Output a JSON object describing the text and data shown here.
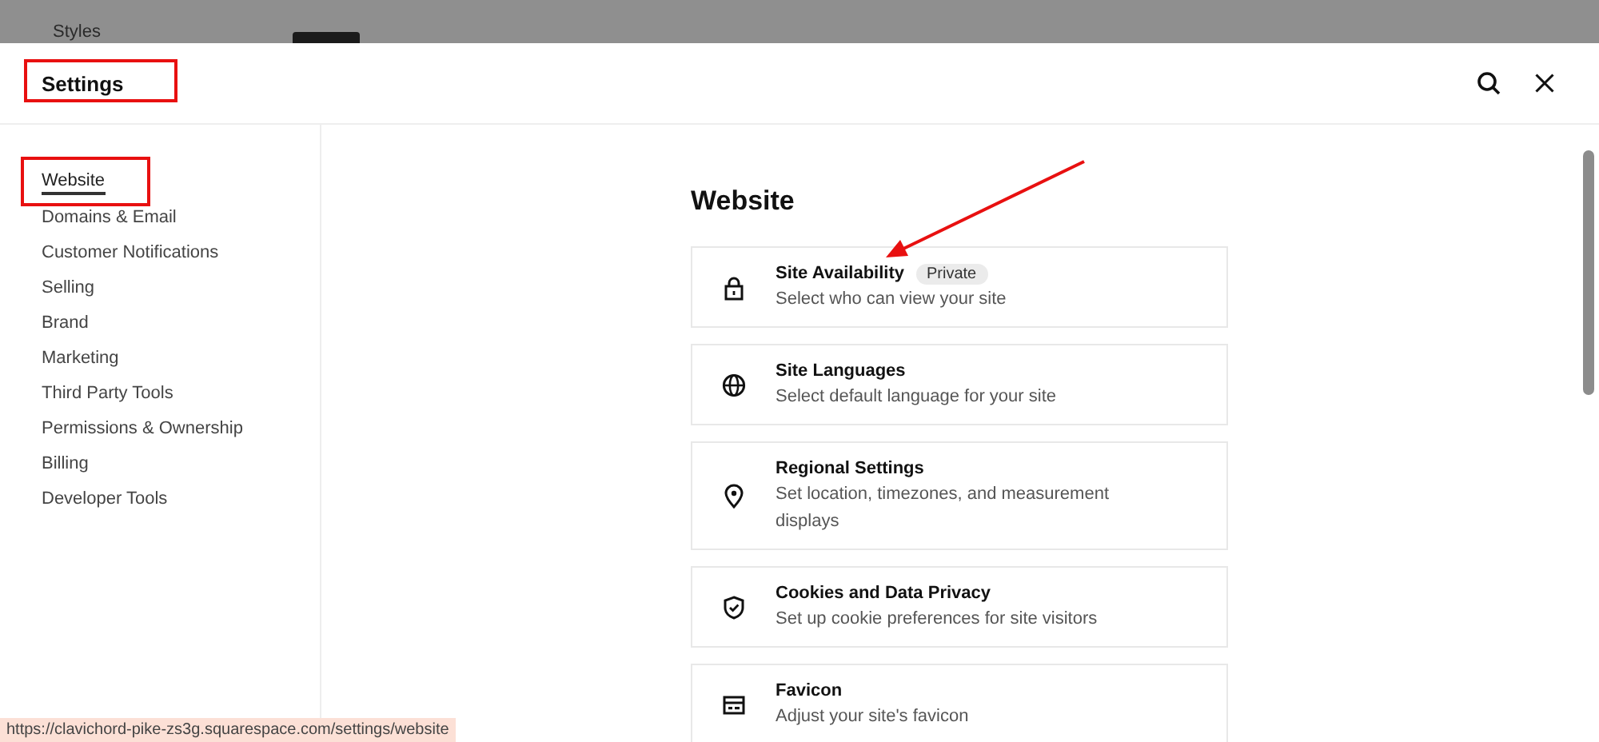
{
  "background": {
    "label": "Styles"
  },
  "header": {
    "title": "Settings"
  },
  "sidebar": {
    "items": [
      {
        "label": "Website",
        "selected": true
      },
      {
        "label": "Domains & Email",
        "selected": false
      },
      {
        "label": "Customer Notifications",
        "selected": false
      },
      {
        "label": "Selling",
        "selected": false
      },
      {
        "label": "Brand",
        "selected": false
      },
      {
        "label": "Marketing",
        "selected": false
      },
      {
        "label": "Third Party Tools",
        "selected": false
      },
      {
        "label": "Permissions & Ownership",
        "selected": false
      },
      {
        "label": "Billing",
        "selected": false
      },
      {
        "label": "Developer Tools",
        "selected": false
      }
    ]
  },
  "content": {
    "heading": "Website",
    "cards": [
      {
        "kind": "lock",
        "title": "Site Availability",
        "badge": "Private",
        "description": "Select who can view your site"
      },
      {
        "kind": "globe",
        "title": "Site Languages",
        "description": "Select default language for your site"
      },
      {
        "kind": "pin",
        "title": "Regional Settings",
        "description": "Set location, timezones, and measurement displays"
      },
      {
        "kind": "shield",
        "title": "Cookies and Data Privacy",
        "description": "Set up cookie preferences for site visitors"
      },
      {
        "kind": "favicon",
        "title": "Favicon",
        "description": "Adjust your site's favicon"
      }
    ]
  },
  "status_bar": {
    "url": "https://clavichord-pike-zs3g.squarespace.com/settings/website"
  }
}
